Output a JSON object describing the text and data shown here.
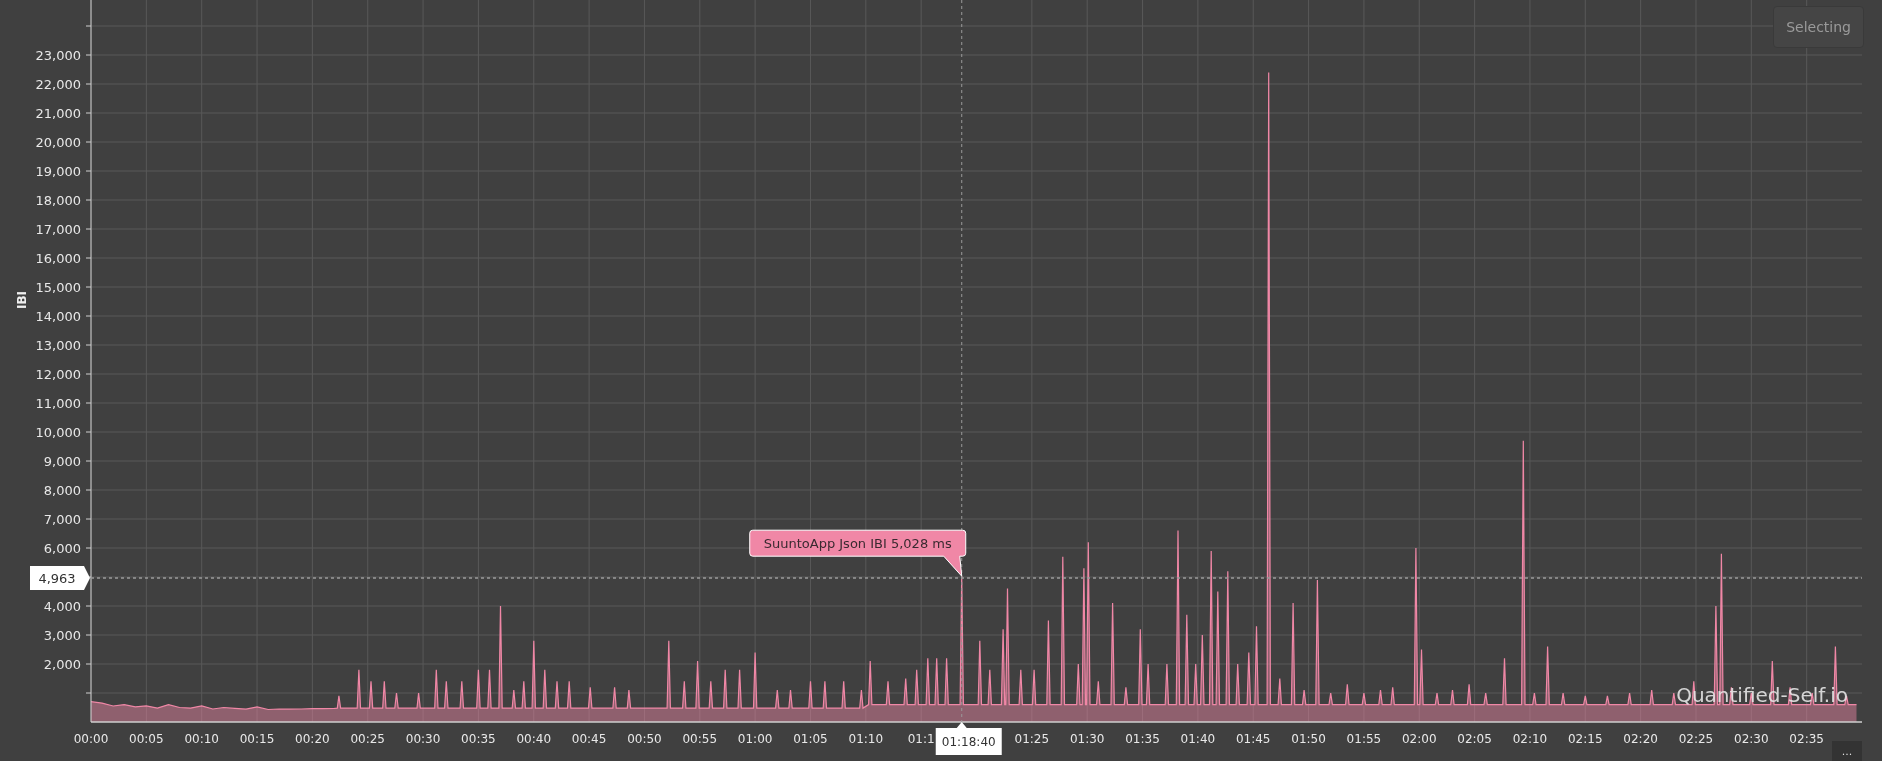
{
  "toolbar": {
    "selection_button": "Selecting",
    "menu_button": "..."
  },
  "chart": {
    "credits": "Quantified-Self.io",
    "crosshair_time": "01:18:40",
    "chart_data": {
      "type": "area",
      "ylabel": "IBI",
      "xlim": [
        0,
        160
      ],
      "ylim": [
        0,
        24000
      ],
      "xticks": [
        {
          "value": 0,
          "label": "00:00"
        },
        {
          "value": 5,
          "label": "00:05"
        },
        {
          "value": 10,
          "label": "00:10"
        },
        {
          "value": 15,
          "label": "00:15"
        },
        {
          "value": 20,
          "label": "00:20"
        },
        {
          "value": 25,
          "label": "00:25"
        },
        {
          "value": 30,
          "label": "00:30"
        },
        {
          "value": 35,
          "label": "00:35"
        },
        {
          "value": 40,
          "label": "00:40"
        },
        {
          "value": 45,
          "label": "00:45"
        },
        {
          "value": 50,
          "label": "00:50"
        },
        {
          "value": 55,
          "label": "00:55"
        },
        {
          "value": 60,
          "label": "01:00"
        },
        {
          "value": 65,
          "label": "01:05"
        },
        {
          "value": 70,
          "label": "01:10"
        },
        {
          "value": 75,
          "label": "01:1"
        },
        {
          "value": 85,
          "label": "01:25"
        },
        {
          "value": 90,
          "label": "01:30"
        },
        {
          "value": 95,
          "label": "01:35"
        },
        {
          "value": 100,
          "label": "01:40"
        },
        {
          "value": 105,
          "label": "01:45"
        },
        {
          "value": 110,
          "label": "01:50"
        },
        {
          "value": 115,
          "label": "01:55"
        },
        {
          "value": 120,
          "label": "02:00"
        },
        {
          "value": 125,
          "label": "02:05"
        },
        {
          "value": 130,
          "label": "02:10"
        },
        {
          "value": 135,
          "label": "02:15"
        },
        {
          "value": 140,
          "label": "02:20"
        },
        {
          "value": 145,
          "label": "02:25"
        },
        {
          "value": 150,
          "label": "02:30"
        },
        {
          "value": 155,
          "label": "02:35"
        }
      ],
      "yticks": [
        {
          "value": 2000,
          "label": "2,000"
        },
        {
          "value": 3000,
          "label": "3,000"
        },
        {
          "value": 4000,
          "label": "4,000"
        },
        {
          "value": 6000,
          "label": "6,000"
        },
        {
          "value": 7000,
          "label": "7,000"
        },
        {
          "value": 8000,
          "label": "8,000"
        },
        {
          "value": 9000,
          "label": "9,000"
        },
        {
          "value": 10000,
          "label": "10,000"
        },
        {
          "value": 11000,
          "label": "11,000"
        },
        {
          "value": 12000,
          "label": "12,000"
        },
        {
          "value": 13000,
          "label": "13,000"
        },
        {
          "value": 14000,
          "label": "14,000"
        },
        {
          "value": 15000,
          "label": "15,000"
        },
        {
          "value": 16000,
          "label": "16,000"
        },
        {
          "value": 17000,
          "label": "17,000"
        },
        {
          "value": 18000,
          "label": "18,000"
        },
        {
          "value": 19000,
          "label": "19,000"
        },
        {
          "value": 20000,
          "label": "20,000"
        },
        {
          "value": 21000,
          "label": "21,000"
        },
        {
          "value": 22000,
          "label": "22,000"
        },
        {
          "value": 23000,
          "label": "23,000"
        }
      ],
      "x": [
        0,
        1,
        2,
        3,
        4,
        5,
        6,
        7,
        8,
        9,
        10,
        11,
        12,
        13,
        14,
        15,
        16,
        17,
        18,
        19,
        20,
        21,
        22,
        22.25,
        22.4,
        22.55,
        24.05,
        24.2,
        24.35,
        25.15,
        25.3,
        25.45,
        26.35,
        26.5,
        26.65,
        27.45,
        27.6,
        27.75,
        29.45,
        29.6,
        29.75,
        31.05,
        31.2,
        31.35,
        31.95,
        32.1,
        32.25,
        33.35,
        33.5,
        33.65,
        34.85,
        35,
        35.15,
        35.85,
        36,
        36.15,
        36.85,
        37,
        37.15,
        38.05,
        38.2,
        38.35,
        38.95,
        39.1,
        39.25,
        39.85,
        40,
        40.15,
        40.85,
        41,
        41.15,
        41.95,
        42.1,
        42.25,
        43.05,
        43.2,
        43.35,
        44.95,
        45.1,
        45.25,
        47.15,
        47.3,
        47.45,
        48.45,
        48.6,
        48.75,
        52.05,
        52.2,
        52.35,
        53.45,
        53.6,
        53.75,
        54.65,
        54.8,
        54.95,
        55.85,
        56,
        56.15,
        57.15,
        57.3,
        57.45,
        58.45,
        58.6,
        58.75,
        59.85,
        60,
        60.15,
        61.85,
        62,
        62.15,
        63.05,
        63.2,
        63.35,
        64.85,
        65,
        65.15,
        66.15,
        66.3,
        66.45,
        67.85,
        68,
        68.15,
        69.45,
        69.6,
        69.75,
        70.25,
        70.4,
        70.55,
        71.85,
        72,
        72.15,
        73.45,
        73.6,
        73.75,
        74.45,
        74.6,
        74.75,
        75.45,
        75.6,
        75.75,
        76.25,
        76.4,
        76.55,
        77.15,
        77.3,
        77.45,
        78.52,
        78.6667,
        78.82,
        80.15,
        80.3,
        80.45,
        81.05,
        81.2,
        81.35,
        82.25,
        82.4,
        82.55,
        82.65,
        82.8,
        82.95,
        83.85,
        84,
        84.15,
        85.05,
        85.2,
        85.35,
        86.35,
        86.5,
        86.65,
        87.65,
        87.8,
        87.95,
        89.05,
        89.2,
        89.35,
        89.55,
        89.7,
        89.85,
        89.95,
        90.1,
        90.25,
        90.85,
        91,
        91.15,
        92.15,
        92.3,
        92.45,
        93.35,
        93.5,
        93.65,
        94.65,
        94.8,
        94.95,
        95.35,
        95.5,
        95.65,
        97.05,
        97.2,
        97.35,
        98.05,
        98.2,
        98.35,
        98.85,
        99,
        99.15,
        99.65,
        99.8,
        99.95,
        100.25,
        100.4,
        100.55,
        101.05,
        101.2,
        101.35,
        101.65,
        101.8,
        101.95,
        102.55,
        102.7,
        102.85,
        103.45,
        103.6,
        103.75,
        104.45,
        104.6,
        104.75,
        105.15,
        105.3,
        105.45,
        106.25,
        106.4,
        106.55,
        107.25,
        107.4,
        107.55,
        108.45,
        108.6,
        108.75,
        109.45,
        109.6,
        109.75,
        110.65,
        110.8,
        110.95,
        111.85,
        112,
        112.15,
        113.35,
        113.5,
        113.65,
        114.85,
        115,
        115.15,
        116.35,
        116.5,
        116.65,
        117.45,
        117.6,
        117.75,
        119.55,
        119.7,
        119.85,
        120.05,
        120.2,
        120.35,
        121.45,
        121.6,
        121.75,
        122.85,
        123,
        123.15,
        124.35,
        124.5,
        124.65,
        125.85,
        126,
        126.15,
        127.55,
        127.7,
        127.85,
        129.25,
        129.4,
        129.55,
        130.25,
        130.4,
        130.55,
        131.45,
        131.6,
        131.75,
        132.85,
        133,
        133.15,
        134.85,
        135,
        135.15,
        136.85,
        137,
        137.15,
        138.85,
        139,
        139.15,
        140.85,
        141,
        141.15,
        142.85,
        143,
        143.15,
        144.65,
        144.8,
        144.95,
        146.65,
        146.8,
        146.95,
        147.15,
        147.3,
        147.45,
        148.05,
        148.2,
        148.35,
        149.85,
        150,
        150.15,
        151.75,
        151.9,
        152.05,
        153.35,
        153.5,
        153.65,
        155.35,
        155.5,
        155.65,
        157.45,
        157.6,
        157.75,
        158.45,
        158.6,
        158.75,
        159.5
      ],
      "series": [
        {
          "color": "#f087a6",
          "values": [
            700,
            650,
            550,
            600,
            520,
            560,
            480,
            600,
            500,
            480,
            560,
            450,
            500,
            470,
            440,
            520,
            430,
            450,
            440,
            450,
            460,
            460,
            470,
            480,
            900,
            480,
            480,
            1800,
            480,
            480,
            1400,
            480,
            480,
            1400,
            480,
            480,
            1000,
            480,
            480,
            1000,
            480,
            480,
            1800,
            480,
            480,
            1400,
            480,
            480,
            1400,
            480,
            480,
            1800,
            480,
            480,
            1800,
            480,
            480,
            4000,
            480,
            480,
            1100,
            480,
            480,
            1400,
            480,
            480,
            2800,
            480,
            480,
            1800,
            480,
            480,
            1400,
            480,
            480,
            1400,
            480,
            480,
            1200,
            480,
            480,
            1200,
            480,
            480,
            1100,
            480,
            480,
            2800,
            480,
            480,
            1400,
            480,
            480,
            2100,
            480,
            480,
            1400,
            480,
            480,
            1800,
            480,
            480,
            1800,
            480,
            480,
            2400,
            480,
            480,
            1100,
            480,
            480,
            1100,
            480,
            480,
            1400,
            480,
            480,
            1400,
            480,
            480,
            1400,
            480,
            480,
            1100,
            480,
            600,
            2100,
            600,
            600,
            1400,
            600,
            600,
            1500,
            600,
            600,
            1800,
            600,
            600,
            2200,
            600,
            600,
            2200,
            600,
            600,
            2200,
            600,
            600,
            5028,
            600,
            600,
            2800,
            600,
            600,
            1800,
            600,
            600,
            3200,
            600,
            600,
            4600,
            600,
            600,
            1800,
            600,
            600,
            1800,
            600,
            600,
            3500,
            600,
            600,
            5700,
            600,
            600,
            2000,
            600,
            600,
            5300,
            600,
            600,
            6200,
            600,
            600,
            1400,
            600,
            600,
            4100,
            600,
            600,
            1200,
            600,
            600,
            3200,
            600,
            600,
            2000,
            600,
            600,
            2000,
            600,
            600,
            6600,
            600,
            600,
            3700,
            600,
            600,
            2000,
            600,
            600,
            3000,
            600,
            600,
            5900,
            600,
            600,
            4500,
            600,
            600,
            5200,
            600,
            600,
            2000,
            600,
            600,
            2400,
            600,
            600,
            3300,
            600,
            600,
            22400,
            600,
            600,
            1500,
            600,
            600,
            4100,
            600,
            600,
            1100,
            600,
            600,
            4900,
            600,
            600,
            1000,
            600,
            600,
            1300,
            600,
            600,
            1000,
            600,
            600,
            1100,
            600,
            600,
            1200,
            600,
            600,
            6000,
            600,
            600,
            2500,
            600,
            600,
            1000,
            600,
            600,
            1100,
            600,
            600,
            1300,
            600,
            600,
            1000,
            600,
            600,
            2200,
            600,
            600,
            9700,
            600,
            600,
            1000,
            600,
            600,
            2600,
            600,
            600,
            1000,
            600,
            600,
            900,
            600,
            600,
            900,
            600,
            600,
            1000,
            600,
            600,
            1100,
            600,
            600,
            1000,
            600,
            600,
            1400,
            600,
            600,
            4000,
            600,
            600,
            5800,
            600,
            600,
            1200,
            600,
            600,
            1000,
            600,
            600,
            2100,
            600,
            600,
            1200,
            600,
            600,
            1000,
            600,
            600,
            2600,
            600,
            600,
            900,
            600,
            600
          ]
        }
      ],
      "grid": true,
      "ref_lines": [
        {
          "axis": "x",
          "value": 78.6667
        },
        {
          "axis": "y",
          "value": 4963,
          "label": "4,963"
        }
      ],
      "annotations": [
        {
          "x": 78.6667,
          "y": 5028,
          "text": "SuuntoApp Json IBI 5,028 ms"
        }
      ]
    }
  }
}
